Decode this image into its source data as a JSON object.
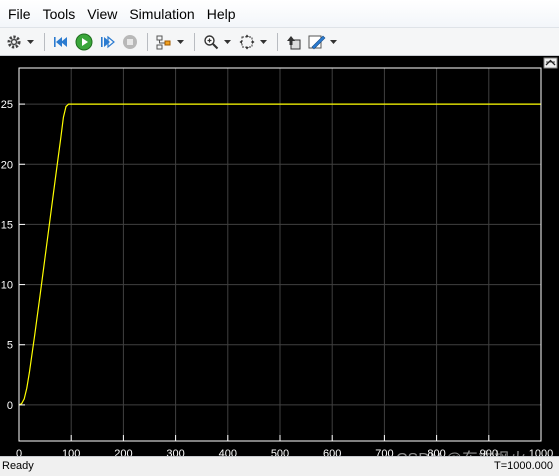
{
  "menu": [
    "File",
    "Tools",
    "View",
    "Simulation",
    "Help"
  ],
  "toolbar": {
    "icons": [
      "gear-icon",
      "rewind-icon",
      "run-icon",
      "step-forward-icon",
      "stop-icon",
      "highlight-icon",
      "zoom-icon",
      "fit-view-icon",
      "restore-icon",
      "style-icon"
    ]
  },
  "status": {
    "left": "Ready",
    "right": "T=1000.000"
  },
  "watermark": "CSDN @东方枫火",
  "colors": {
    "trace": "#ffff00",
    "axes": "#ffffff",
    "background": "#000000",
    "grid": "#404040"
  },
  "chart_data": {
    "type": "line",
    "title": "",
    "xlabel": "",
    "ylabel": "",
    "xlim": [
      0,
      1000
    ],
    "ylim": [
      -3,
      28
    ],
    "x_ticks": [
      "0",
      "100",
      "200",
      "300",
      "400",
      "500",
      "600",
      "700",
      "800",
      "900",
      "1000"
    ],
    "y_ticks": [
      "0",
      "5",
      "10",
      "15",
      "20",
      "25"
    ],
    "grid": true,
    "series": [
      {
        "x": [
          0,
          5,
          10,
          15,
          20,
          30,
          40,
          50,
          60,
          70,
          80,
          85,
          90,
          95,
          100,
          150,
          200,
          300,
          400,
          500,
          600,
          700,
          800,
          900,
          1000
        ],
        "y": [
          0,
          0.1,
          0.5,
          1.4,
          2.7,
          5.8,
          9.0,
          12.3,
          15.6,
          18.9,
          22.2,
          23.9,
          24.8,
          25.0,
          25.0,
          25.0,
          25.0,
          25.0,
          25.0,
          25.0,
          25.0,
          25.0,
          25.0,
          25.0,
          25.0
        ]
      }
    ]
  }
}
